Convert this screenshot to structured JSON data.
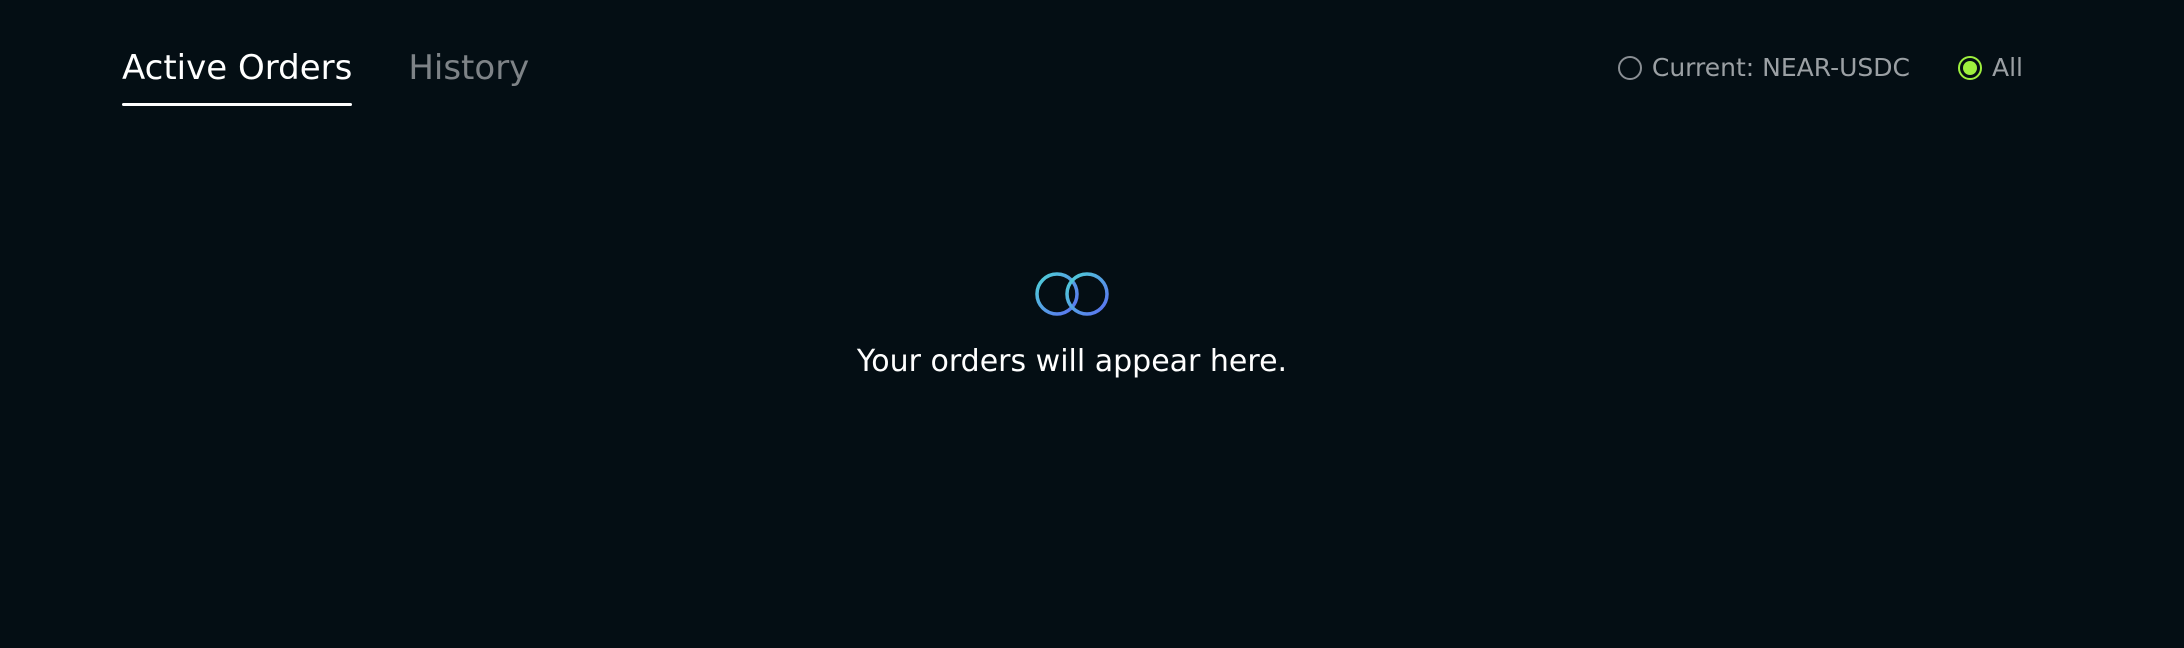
{
  "tabs": [
    {
      "label": "Active Orders",
      "active": true
    },
    {
      "label": "History",
      "active": false
    }
  ],
  "filters": [
    {
      "label": "Current: NEAR-USDC",
      "selected": false
    },
    {
      "label": "All",
      "selected": true
    }
  ],
  "empty_state": {
    "icon": "orders-rings-icon",
    "message": "Your orders will appear here."
  },
  "colors": {
    "background": "#040e14",
    "accent": "#9ef03e",
    "ring_start": "#4ed3d6",
    "ring_end": "#5b6df2"
  }
}
